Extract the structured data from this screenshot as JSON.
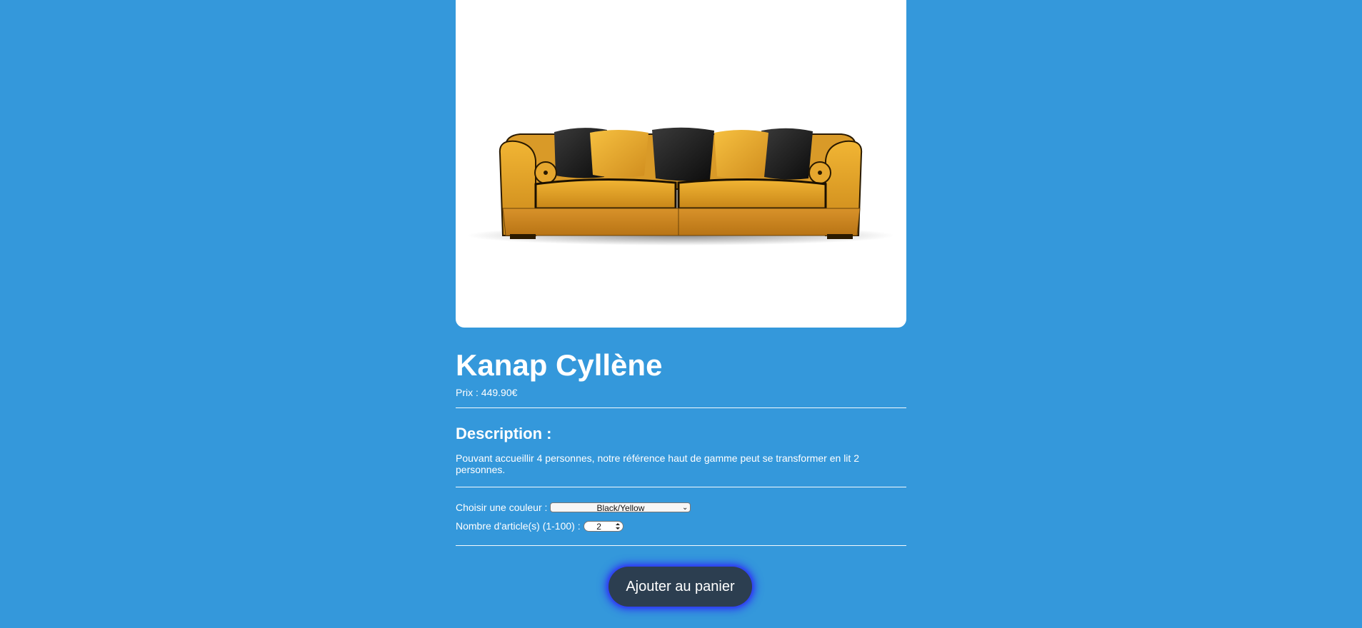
{
  "product": {
    "image_alt": "Photographie d'un canapé",
    "title": "Kanap Cyllène",
    "price_label": "Prix : ",
    "price_value": "449.90",
    "currency": "€",
    "description_title": "Description :",
    "description_text": "Pouvant accueillir 4 personnes, notre référence haut de gamme peut se transformer en lit 2 personnes."
  },
  "options": {
    "color_label": "Choisir une couleur :",
    "color_selected": "Black/Yellow",
    "quantity_label": "Nombre d'article(s) (1-100) :",
    "quantity_value": "2"
  },
  "actions": {
    "add_to_cart_label": "Ajouter au panier"
  },
  "colors": {
    "background": "#3498db",
    "button": "#2c3e50",
    "button_glow": "#2c3aef",
    "sofa_body": "#e0a02a",
    "pillow_black": "#1a1a1a"
  }
}
